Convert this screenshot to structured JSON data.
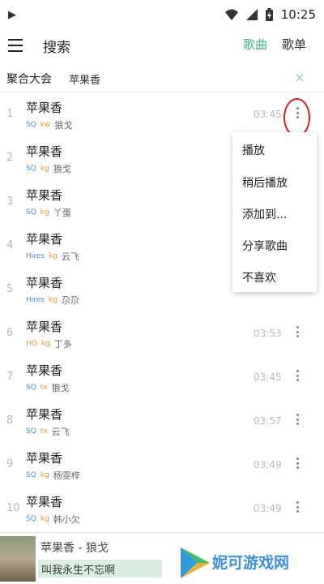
{
  "status_bar": {
    "time": "10:25"
  },
  "header": {
    "title": "搜索",
    "tabs": [
      {
        "label": "歌曲",
        "active": true
      },
      {
        "label": "歌单",
        "active": false
      }
    ]
  },
  "source_bar": {
    "source": "聚合大会",
    "query": "苹果香",
    "clear_symbol": "×"
  },
  "songs": [
    {
      "index": "1",
      "title": "苹果香",
      "quality": "SQ",
      "source": "kw",
      "artist": "狼戈",
      "duration": "03:45"
    },
    {
      "index": "2",
      "title": "苹果香",
      "quality": "SQ",
      "source": "kg",
      "artist": "狼戈",
      "duration": ""
    },
    {
      "index": "3",
      "title": "苹果香",
      "quality": "SQ",
      "source": "kg",
      "artist": "丫蛋",
      "duration": ""
    },
    {
      "index": "4",
      "title": "苹果香",
      "quality": "Hires",
      "source": "kg",
      "artist": "云飞",
      "duration": ""
    },
    {
      "index": "5",
      "title": "苹果香",
      "quality": "Hires",
      "source": "kg",
      "artist": "尕尕",
      "duration": ""
    },
    {
      "index": "6",
      "title": "苹果香",
      "quality": "HQ",
      "source": "kg",
      "artist": "丁多",
      "duration": "03:53"
    },
    {
      "index": "7",
      "title": "苹果香",
      "quality": "SQ",
      "source": "tx",
      "artist": "狼戈",
      "duration": "03:45"
    },
    {
      "index": "8",
      "title": "苹果香",
      "quality": "SQ",
      "source": "tx",
      "artist": "云飞",
      "duration": "03:57"
    },
    {
      "index": "9",
      "title": "苹果香",
      "quality": "SQ",
      "source": "kg",
      "artist": "杨雯梓",
      "duration": "03:49"
    },
    {
      "index": "10",
      "title": "苹果香",
      "quality": "SQ",
      "source": "kg",
      "artist": "韩小欠",
      "duration": "03:49"
    }
  ],
  "context_menu": {
    "items": [
      "播放",
      "稍后播放",
      "添加到...",
      "分享歌曲",
      "不喜欢"
    ]
  },
  "player": {
    "now_playing": "苹果香 - 狼戈",
    "lyric": "叫我永生不忘啊"
  },
  "watermark": {
    "text": "妮可游戏网"
  },
  "colors": {
    "accent": "#4caf82",
    "highlight_ring": "#d32020",
    "quality_sq": "#4a8fe0",
    "quality_hq": "#e89a2d"
  }
}
